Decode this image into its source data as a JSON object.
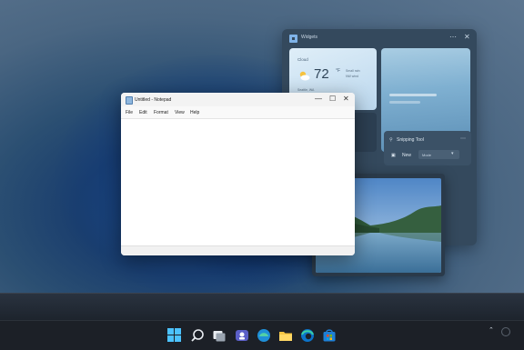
{
  "widgets": {
    "title": "Widgets",
    "controls": {
      "more": "⋯",
      "close": "✕"
    },
    "weather": {
      "condition": "Cloud",
      "temp": "72",
      "unit": "°F",
      "details": [
        "Small rain",
        "NW wind"
      ],
      "location": "Seattle, WA"
    },
    "snipping": {
      "title": "Snipping Tool",
      "more": "⋯",
      "new_label": "New",
      "mode_label": "Mode",
      "chevron": "▾"
    }
  },
  "notepad": {
    "title": "Untitled - Notepad",
    "controls": {
      "minimize": "—",
      "maximize": "☐",
      "close": "✕"
    },
    "menu": [
      "File",
      "Edit",
      "Format",
      "View",
      "Help"
    ]
  },
  "taskbar": {
    "icons": [
      "start-icon",
      "search-icon",
      "task-view-icon",
      "chat-icon",
      "edge-icon",
      "file-explorer-icon",
      "edge-browser-icon",
      "store-icon"
    ],
    "tray_chevron": "⌃",
    "accent": "#4cc2ff"
  },
  "colors": {
    "widgets_bg": "#34495d",
    "notepad_bg": "#f9f9f9",
    "taskbar_bg": "#1c2027"
  }
}
